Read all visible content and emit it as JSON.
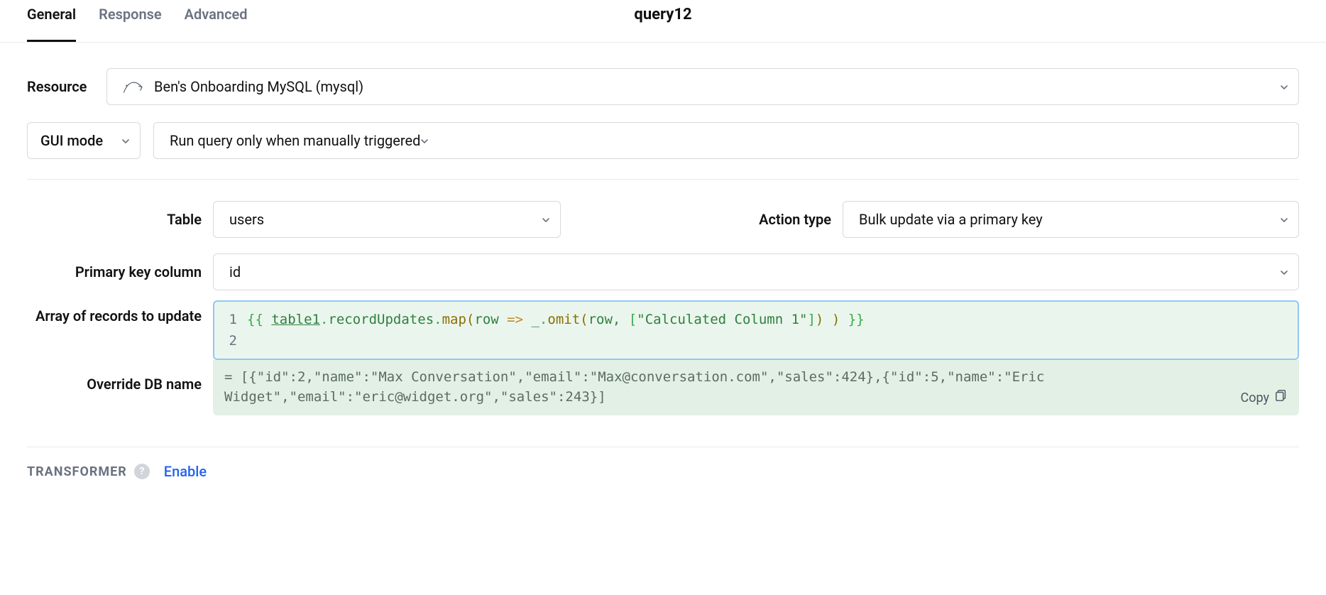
{
  "tabs": {
    "general": "General",
    "response": "Response",
    "advanced": "Advanced"
  },
  "query_name": "query12",
  "labels": {
    "resource": "Resource",
    "gui_mode": "GUI mode",
    "table": "Table",
    "action_type": "Action type",
    "primary_key": "Primary key column",
    "array_records": "Array of records to update",
    "override_db": "Override DB name",
    "transformer": "TRANSFORMER",
    "enable": "Enable",
    "copy": "Copy"
  },
  "values": {
    "resource": "Ben's Onboarding MySQL (mysql)",
    "trigger_mode": "Run query only when manually triggered",
    "table": "users",
    "action_type": "Bulk update via a primary key",
    "primary_key": "id"
  },
  "code": {
    "line1_tokens": {
      "open": "{{ ",
      "ident": "table1",
      "dot1": ".",
      "p1": "recordUpdates",
      "dot2": ".",
      "fn": "map",
      "lp": "(",
      "arg": "row ",
      "arrow": "=>",
      "sp": " _",
      "dot3": ".",
      "omit": "omit",
      "lp2": "(",
      "arg2": "row, ",
      "lb": "[",
      "str": "\"Calculated Column 1\"",
      "rb": "]",
      "rp2": ")",
      "sp2": " ",
      "rp": ")",
      "close": " }}"
    },
    "gutter1": "1",
    "gutter2": "2"
  },
  "eval_text": "= [{\"id\":2,\"name\":\"Max Conversation\",\"email\":\"Max@conversation.com\",\"sales\":424},{\"id\":5,\"name\":\"Eric Widget\",\"email\":\"eric@widget.org\",\"sales\":243}]"
}
